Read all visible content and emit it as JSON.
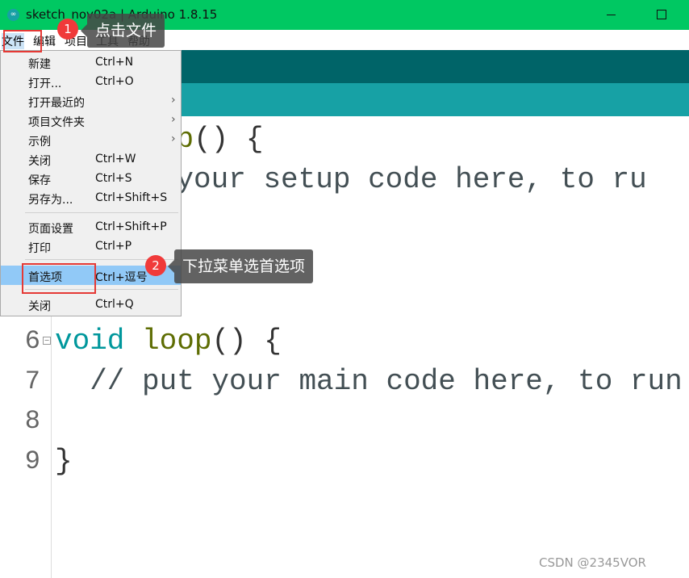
{
  "window": {
    "title": "sketch_nov02a | Arduino 1.8.15",
    "logo": "arduino-logo"
  },
  "menubar": [
    "文件",
    "编辑",
    "项目",
    "工具",
    "帮助"
  ],
  "file_menu": [
    {
      "label": "新建",
      "shortcut": "Ctrl+N"
    },
    {
      "label": "打开...",
      "shortcut": "Ctrl+O"
    },
    {
      "label": "打开最近的",
      "shortcut": "",
      "submenu": true
    },
    {
      "label": "项目文件夹",
      "shortcut": "",
      "submenu": true
    },
    {
      "label": "示例",
      "shortcut": "",
      "submenu": true
    },
    {
      "label": "关闭",
      "shortcut": "Ctrl+W"
    },
    {
      "label": "保存",
      "shortcut": "Ctrl+S"
    },
    {
      "label": "另存为...",
      "shortcut": "Ctrl+Shift+S"
    },
    {
      "label": "页面设置",
      "shortcut": "Ctrl+Shift+P"
    },
    {
      "label": "打印",
      "shortcut": "Ctrl+P"
    },
    {
      "label": "首选项",
      "shortcut": "Ctrl+逗号",
      "highlighted": true
    },
    {
      "label": "关闭",
      "shortcut": "Ctrl+Q"
    }
  ],
  "annotations": [
    {
      "number": "1",
      "text": "点击文件"
    },
    {
      "number": "2",
      "text": "下拉菜单选首选项"
    }
  ],
  "editor": {
    "line_numbers": [
      "6",
      "7",
      "8",
      "9"
    ],
    "line1_fn": "setup",
    "line1_rest": "() {",
    "line2": "  // put your setup code here, to ru",
    "line6_kw": "void",
    "line6_fn": "loop",
    "line6_rest": "() {",
    "line7": "  // put your main code here, to run",
    "line9": "}"
  },
  "watermark": "CSDN @2345VOR",
  "colors": {
    "titlebar": "#00c862",
    "toolbar": "#006468",
    "tabbar": "#17a1a5",
    "highlight": "#91c9f7"
  }
}
